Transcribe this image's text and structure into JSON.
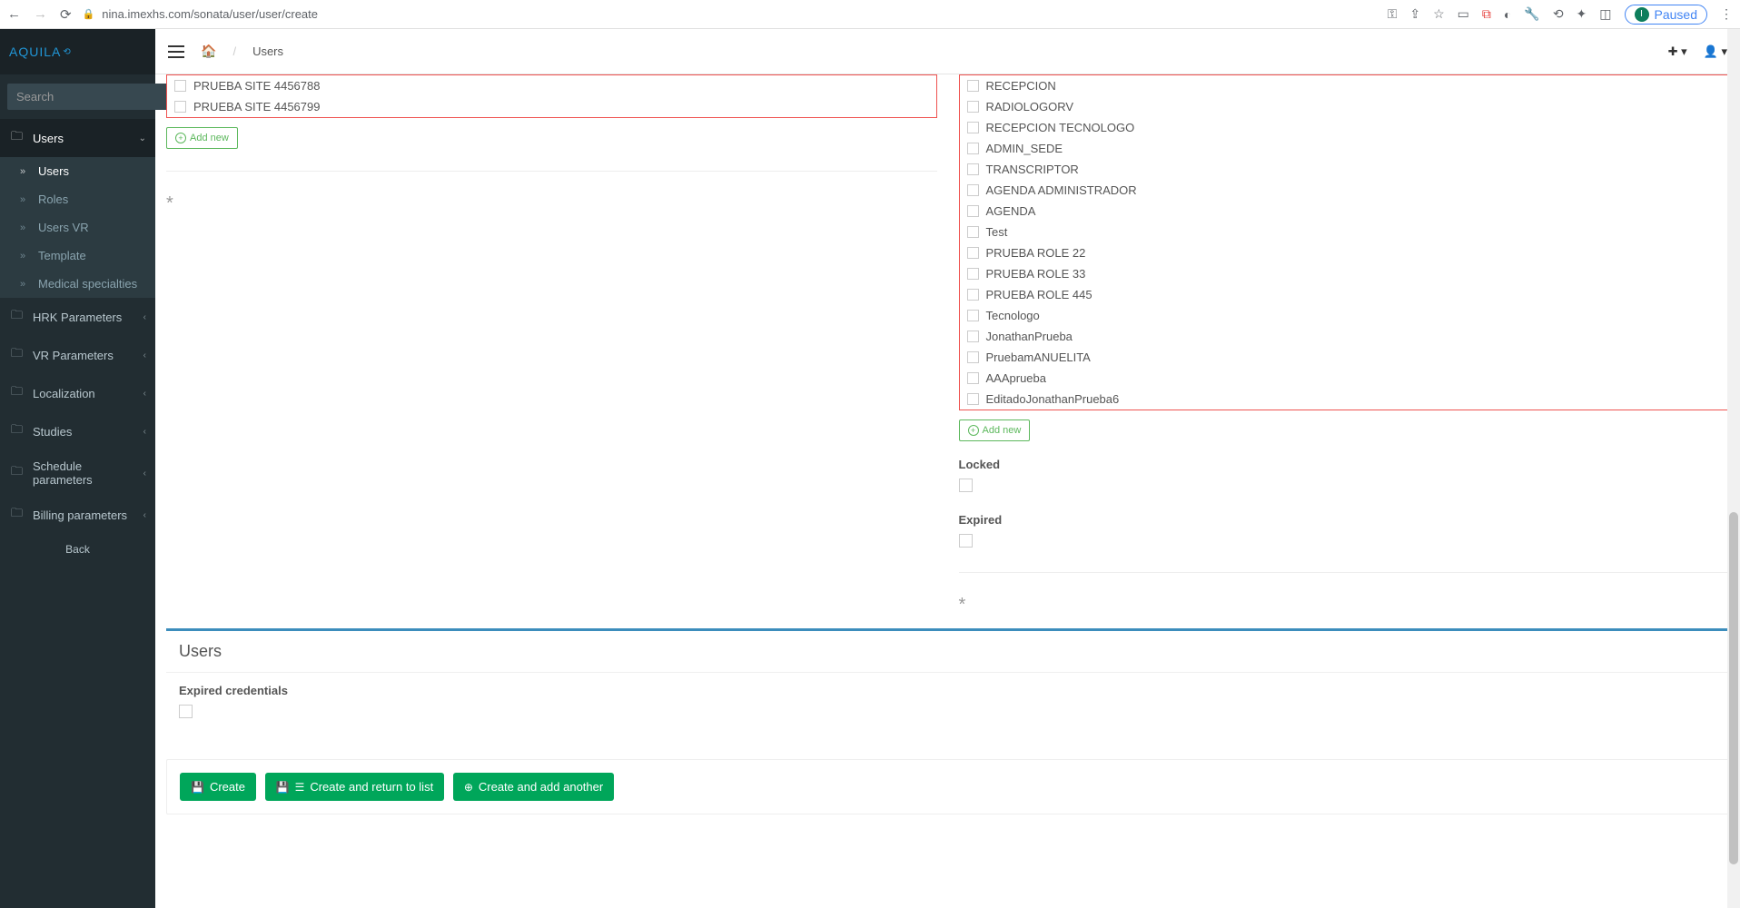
{
  "browser": {
    "url": "nina.imexhs.com/sonata/user/user/create",
    "paused": "Paused",
    "profile_initial": "I"
  },
  "app": {
    "logo": "AQUILA",
    "search_placeholder": "Search"
  },
  "sidebar": {
    "users": {
      "label": "Users",
      "items": [
        {
          "label": "Users"
        },
        {
          "label": "Roles"
        },
        {
          "label": "Users VR"
        },
        {
          "label": "Template"
        },
        {
          "label": "Medical specialties"
        }
      ]
    },
    "others": [
      {
        "label": "HRK Parameters"
      },
      {
        "label": "VR Parameters"
      },
      {
        "label": "Localization"
      },
      {
        "label": "Studies"
      },
      {
        "label": "Schedule parameters"
      },
      {
        "label": "Billing parameters"
      }
    ],
    "back": "Back"
  },
  "breadcrumb": {
    "page": "Users"
  },
  "left_col": {
    "sites": [
      "PRUEBA SITE 4456788",
      "PRUEBA SITE 4456799"
    ],
    "add_new": "Add new"
  },
  "right_col": {
    "roles": [
      "RECEPCION",
      "RADIOLOGORV",
      "RECEPCION TECNOLOGO",
      "ADMIN_SEDE",
      "TRANSCRIPTOR",
      "AGENDA ADMINISTRADOR",
      "AGENDA",
      "Test",
      "PRUEBA ROLE 22",
      "PRUEBA ROLE 33",
      "PRUEBA ROLE 445",
      "Tecnologo",
      "JonathanPrueba",
      "PruebamANUELITA",
      "AAAprueba",
      "EditadoJonathanPrueba6"
    ],
    "add_new": "Add new",
    "locked_label": "Locked",
    "expired_label": "Expired"
  },
  "users_panel": {
    "title": "Users",
    "expired_credentials_label": "Expired credentials"
  },
  "actions": {
    "create": "Create",
    "create_return": "Create and return to list",
    "create_add": "Create and add another"
  }
}
